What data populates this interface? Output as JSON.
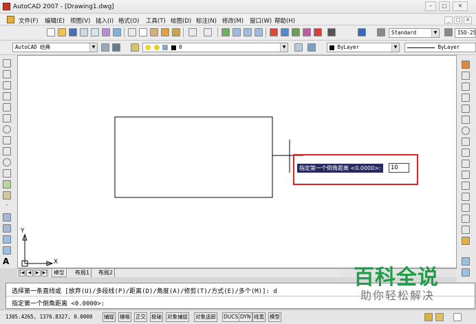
{
  "window": {
    "title": "AutoCAD 2007 - [Drawing1.dwg]",
    "controls": [
      "–",
      "□",
      "✕"
    ],
    "mdi_controls": [
      "_",
      "□",
      "✕"
    ]
  },
  "menu": {
    "items": [
      "文件(F)",
      "编辑(E)",
      "视图(V)",
      "插入(I)",
      "格式(O)",
      "工具(T)",
      "绘图(D)",
      "标注(N)",
      "修改(M)",
      "窗口(W)",
      "帮助(H)"
    ]
  },
  "toolbar_standard": {
    "text_style": "Standard",
    "dim_style": "ISO-25"
  },
  "toolbar_layers": {
    "workspace": "AutoCAD 经典",
    "layer": "0",
    "color": "ByLayer",
    "linetype": "ByLayer"
  },
  "drawing": {
    "prompt_label": "指定第一个倒角距离 <0.0000>:",
    "input_value": "10",
    "ucs_x": "X",
    "ucs_y": "Y"
  },
  "tabs": {
    "nav": [
      "|◀",
      "◀",
      "▶",
      "▶|"
    ],
    "items": [
      "模型",
      "布局1",
      "布局2"
    ]
  },
  "command": {
    "line1": "选择第一条直线或 [放弃(U)/多段线(P)/距离(D)/角度(A)/修剪(T)/方式(E)/多个(M)]:  d",
    "line2": "指定第一个倒角距离 <0.0000>:"
  },
  "status": {
    "coords": "1305.4265, 1376.8327, 0.0000",
    "buttons": [
      "捕捉",
      "栅格",
      "正交",
      "极轴",
      "对象捕捉",
      "对象追踪",
      "DUCS",
      "DYN",
      "线宽",
      "模型"
    ]
  },
  "watermark": {
    "title": "百科全说",
    "subtitle": "助你轻松解决"
  },
  "colors": {
    "prompt_bg": "#27295e",
    "highlight_border": "#e02020",
    "watermark_green": "#1e9e48",
    "layer_color_swatch": "#000000"
  }
}
